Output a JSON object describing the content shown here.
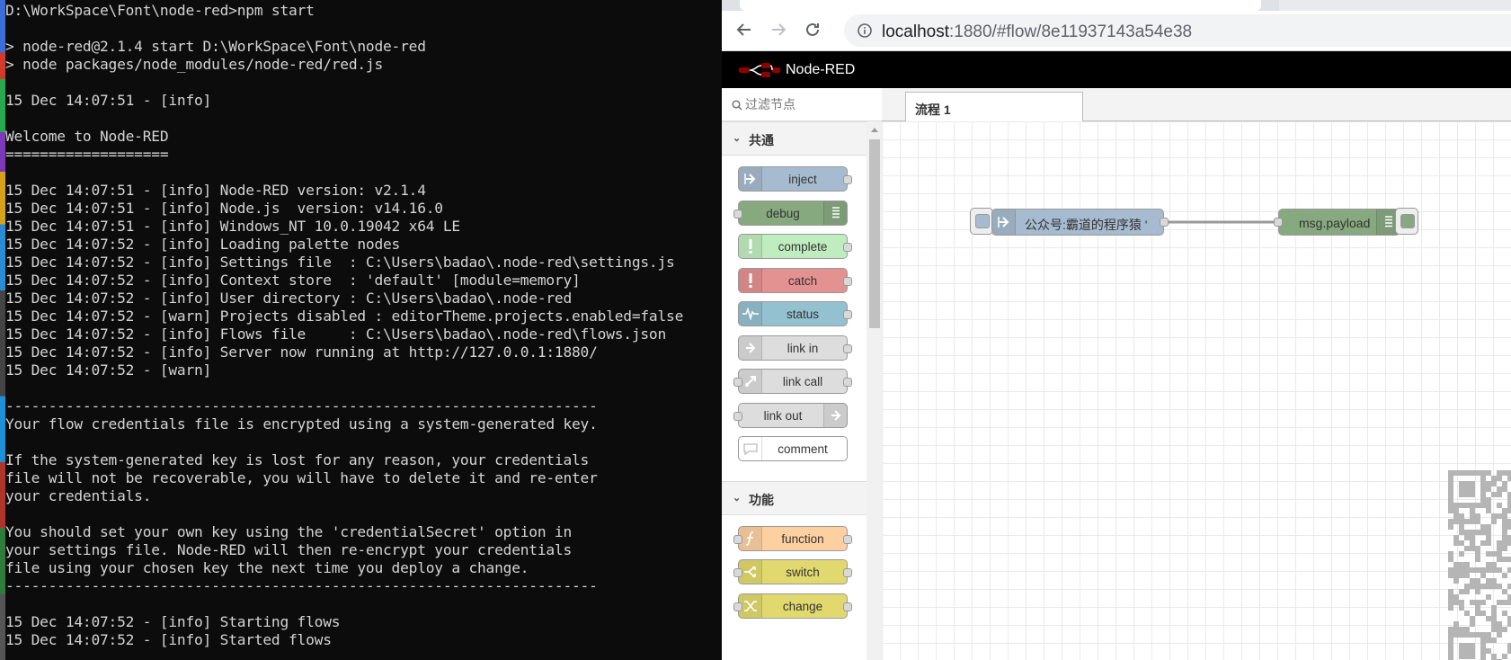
{
  "terminal": {
    "lines": [
      "D:\\WorkSpace\\Font\\node-red>npm start",
      "",
      "> node-red@2.1.4 start D:\\WorkSpace\\Font\\node-red",
      "> node packages/node_modules/node-red/red.js",
      "",
      "15 Dec 14:07:51 - [info]",
      "",
      "Welcome to Node-RED",
      "===================",
      "",
      "15 Dec 14:07:51 - [info] Node-RED version: v2.1.4",
      "15 Dec 14:07:51 - [info] Node.js  version: v14.16.0",
      "15 Dec 14:07:51 - [info] Windows_NT 10.0.19042 x64 LE",
      "15 Dec 14:07:52 - [info] Loading palette nodes",
      "15 Dec 14:07:52 - [info] Settings file  : C:\\Users\\badao\\.node-red\\settings.js",
      "15 Dec 14:07:52 - [info] Context store  : 'default' [module=memory]",
      "15 Dec 14:07:52 - [info] User directory : C:\\Users\\badao\\.node-red",
      "15 Dec 14:07:52 - [warn] Projects disabled : editorTheme.projects.enabled=false",
      "15 Dec 14:07:52 - [info] Flows file     : C:\\Users\\badao\\.node-red\\flows.json",
      "15 Dec 14:07:52 - [info] Server now running at http://127.0.0.1:1880/",
      "15 Dec 14:07:52 - [warn]",
      "",
      "---------------------------------------------------------------------",
      "Your flow credentials file is encrypted using a system-generated key.",
      "",
      "If the system-generated key is lost for any reason, your credentials",
      "file will not be recoverable, you will have to delete it and re-enter",
      "your credentials.",
      "",
      "You should set your own key using the 'credentialSecret' option in",
      "your settings file. Node-RED will then re-encrypt your credentials",
      "file using your chosen key the next time you deploy a change.",
      "---------------------------------------------------------------------",
      "",
      "15 Dec 14:07:52 - [info] Starting flows",
      "15 Dec 14:07:52 - [info] Started flows"
    ]
  },
  "browser": {
    "url_host": "localhost",
    "url_path": ":1880/#flow/8e11937143a54e38",
    "back_icon": "arrow-left-icon",
    "forward_icon": "arrow-right-icon",
    "reload_icon": "reload-icon",
    "info_icon": "info-icon"
  },
  "nodered": {
    "title": "Node-RED",
    "search_placeholder": "过滤节点",
    "categories": [
      {
        "label": "共通",
        "nodes": [
          {
            "label": "inject",
            "color": "#a6bbcf",
            "icon": "arrow-in-icon",
            "icon_side": "left",
            "ports": "out"
          },
          {
            "label": "debug",
            "color": "#87a980",
            "icon": "list-icon",
            "icon_side": "right",
            "ports": "in"
          },
          {
            "label": "complete",
            "color": "#c0edc0",
            "icon": "exclamation-icon",
            "icon_side": "left",
            "ports": "out"
          },
          {
            "label": "catch",
            "color": "#e49191",
            "icon": "exclamation-icon",
            "icon_side": "left",
            "ports": "out"
          },
          {
            "label": "status",
            "color": "#94c1d0",
            "icon": "pulse-icon",
            "icon_side": "left",
            "ports": "out"
          },
          {
            "label": "link in",
            "color": "#dddddd",
            "icon": "link-arrow-icon",
            "icon_side": "left",
            "ports": "out"
          },
          {
            "label": "link call",
            "color": "#dddddd",
            "icon": "link-call-icon",
            "icon_side": "left",
            "ports": "both"
          },
          {
            "label": "link out",
            "color": "#dddddd",
            "icon": "link-arrow-icon",
            "icon_side": "right",
            "ports": "in"
          },
          {
            "label": "comment",
            "color": "#ffffff",
            "icon": "comment-icon",
            "icon_side": "left",
            "ports": "none"
          }
        ]
      },
      {
        "label": "功能",
        "nodes": [
          {
            "label": "function",
            "color": "#fdd0a2",
            "icon": "function-icon",
            "icon_side": "left",
            "ports": "both"
          },
          {
            "label": "switch",
            "color": "#e2d96e",
            "icon": "switch-icon",
            "icon_side": "left",
            "ports": "both"
          },
          {
            "label": "change",
            "color": "#e2d96e",
            "icon": "shuffle-icon",
            "icon_side": "left",
            "ports": "both"
          }
        ]
      }
    ],
    "workspace_tab": "流程 1",
    "flow_nodes": {
      "inject": {
        "label": "公众号:霸道的程序猿 '",
        "color": "#a6bbcf"
      },
      "debug": {
        "label": "msg.payload",
        "color": "#87a980"
      }
    },
    "qr_icon": "qr-code-icon"
  }
}
